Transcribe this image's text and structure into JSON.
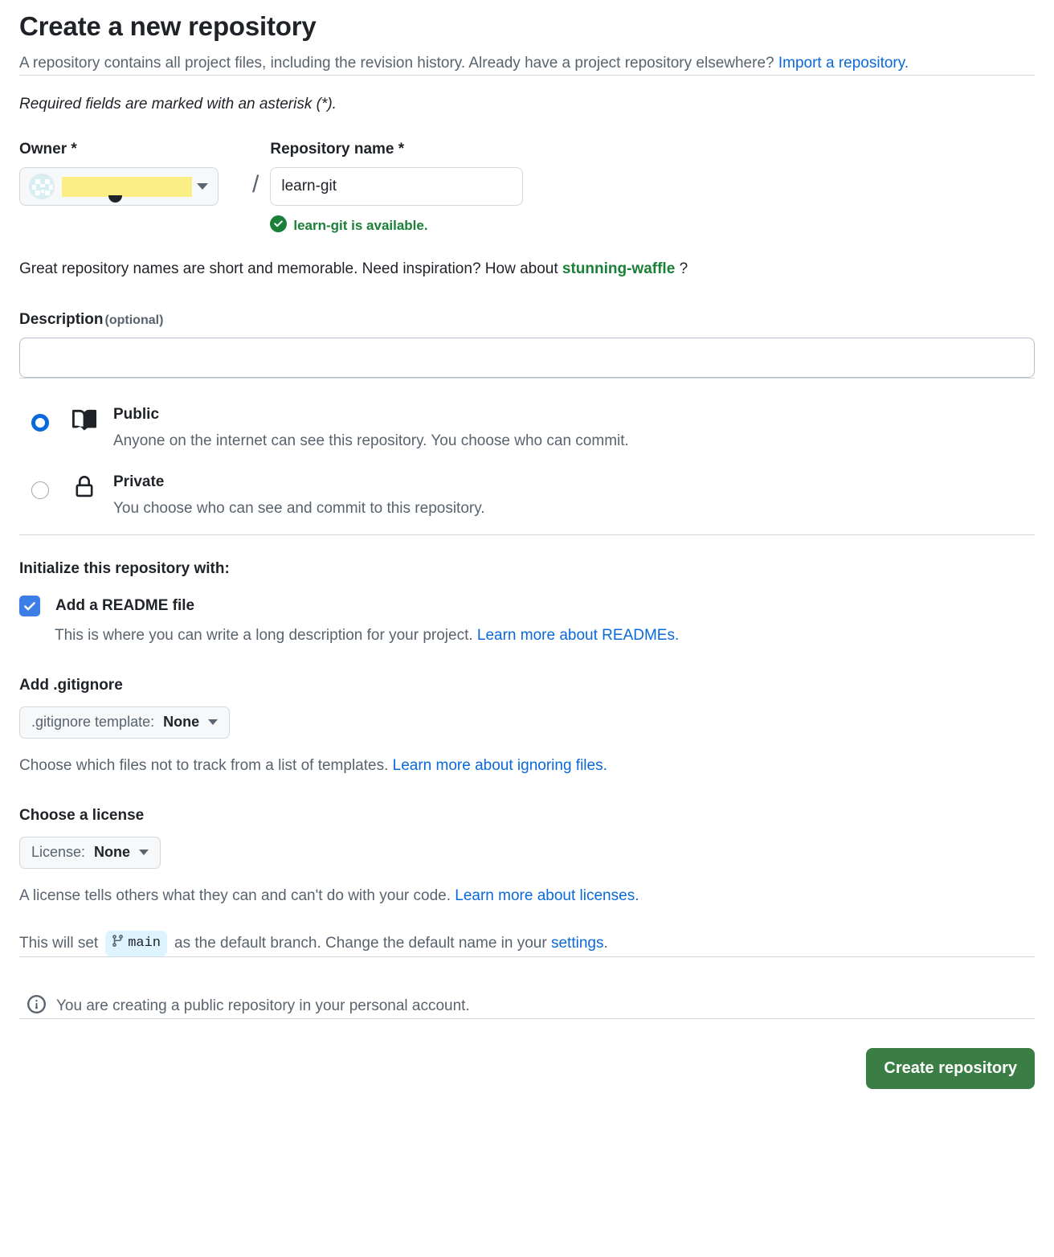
{
  "header": {
    "title": "Create a new repository",
    "subtitle_part1": "A repository contains all project files, including the revision history. Already have a project repository elsewhere? ",
    "import_link": "Import a repository.",
    "required_note": "Required fields are marked with an asterisk (*)."
  },
  "owner": {
    "label": "Owner *",
    "name_redacted": "",
    "avatar_icon": "identicon-avatar-icon",
    "caret_icon": "chevron-down-icon"
  },
  "repo_name": {
    "label": "Repository name *",
    "separator": "/",
    "value": "learn-git",
    "placeholder": "",
    "availability": "learn-git is available.",
    "availability_icon": "check-circle-icon",
    "hint_prefix": "Great repository names are short and memorable. Need inspiration? How about ",
    "hint_suggestion": "stunning-waffle",
    "hint_suffix": "?"
  },
  "description": {
    "label": "Description",
    "optional": "(optional)",
    "value": "",
    "placeholder": ""
  },
  "visibility": {
    "options": [
      {
        "title": "Public",
        "desc": "Anyone on the internet can see this repository. You choose who can commit.",
        "icon": "repo-book-icon",
        "selected": true
      },
      {
        "title": "Private",
        "desc": "You choose who can see and commit to this repository.",
        "icon": "lock-icon",
        "selected": false
      }
    ]
  },
  "initialize": {
    "heading": "Initialize this repository with:",
    "readme": {
      "label": "Add a README file",
      "checked": true,
      "note_prefix": "This is where you can write a long description for your project. ",
      "note_link": "Learn more about READMEs."
    },
    "gitignore": {
      "heading": "Add .gitignore",
      "dropdown_prefix": ".gitignore template:",
      "dropdown_value": "None",
      "note_prefix": "Choose which files not to track from a list of templates. ",
      "note_link": "Learn more about ignoring files."
    },
    "license": {
      "heading": "Choose a license",
      "dropdown_prefix": "License:",
      "dropdown_value": "None",
      "note_prefix": "A license tells others what they can and can't do with your code. ",
      "note_link": "Learn more about licenses."
    }
  },
  "branch_note": {
    "prefix": "This will set",
    "branch_icon": "git-branch-icon",
    "branch_name": "main",
    "middle": "as the default branch. Change the default name in your",
    "link": "settings",
    "suffix": "."
  },
  "notice": {
    "icon": "info-icon",
    "text": "You are creating a public repository in your personal account."
  },
  "footer": {
    "create_label": "Create repository"
  },
  "colors": {
    "accent_blue": "#0969da",
    "success_green": "#1a7f37",
    "button_green": "#3b7e45",
    "muted_text": "#59636e",
    "redaction_yellow": "#faee84",
    "branch_badge_bg": "#ddf4ff"
  }
}
